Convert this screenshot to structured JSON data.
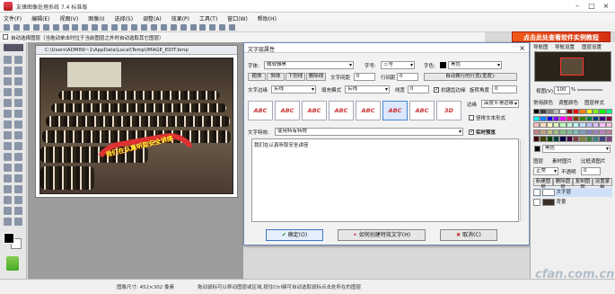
{
  "window": {
    "title": "友锋图像处理系统 7.4 标准版"
  },
  "menu": [
    "文件(F)",
    "编辑(E)",
    "视图(V)",
    "图像(I)",
    "选择(S)",
    "调整(A)",
    "效果(P)",
    "工具(T)",
    "窗口(W)",
    "帮助(H)"
  ],
  "options_bar": {
    "auto_select_layer": "自动选择图层（当拖动单击时位于当前图层之外时自动选取其它图层）"
  },
  "promo": {
    "label": "点击此处查看软件实例教程"
  },
  "image_window": {
    "path": "C:\\Users\\ADMINI~1\\AppData\\Local\\Temp\\IMAGE_EDIT.bmp",
    "overlay_text": "我们在认真听取安全讲座"
  },
  "dialog": {
    "title": "文字层属性",
    "font_label": "字体:",
    "font_value": "微软雅黑",
    "size_label": "字号:",
    "size_value": "三号",
    "color_label": "字色:",
    "color_value": "黑色",
    "style_buttons": [
      "粗体",
      "斜体",
      "下划线",
      "删除线"
    ],
    "spacing_label": "文字间距",
    "spacing_value": "0",
    "linespacing_label": "行间距",
    "linespacing_value": "0",
    "auto_wrap_label": "自动换行的行宽(宽度):",
    "text_edge_label": "文字边缘",
    "text_edge_value": "实线",
    "fill_mode_label": "填充模式",
    "fill_mode_value": "实线",
    "line_width_label": "线宽",
    "line_width_value": "0",
    "smooth_label": "抗锯齿边缘",
    "rotate_label": "旋转角度",
    "rotate_value": "0",
    "border_label": "边缘",
    "border_value": "高度平滑边缘",
    "effect_samples": [
      "ABC",
      "ABC",
      "ABC",
      "ABC",
      "ABC",
      "ABC",
      "ABC",
      "3D"
    ],
    "vertical_label": "竖排文本形式",
    "text_effect_label": "文字特效:",
    "text_effect_value": "使用特有特效",
    "realtime_label": "实时预览",
    "content": "我们在认真听取安全讲座",
    "ok_label": "确定(O)",
    "create_effect_label": "如何创建特效文字(H)",
    "cancel_label": "取消(C)"
  },
  "right_panel": {
    "tabs": [
      "导航图",
      "导航设置",
      "图层设置"
    ],
    "zoom_label": "视图(V)",
    "zoom_value": "100",
    "zoom_percent": "%",
    "palette_tabs": [
      "常用颜色",
      "调整颜色",
      "图层样式"
    ],
    "palette_colors": [
      "#000000",
      "#3f3f3f",
      "#7f7f7f",
      "#bfbfbf",
      "#ffffff",
      "#7f0000",
      "#ff0000",
      "#ff7f00",
      "#ffff00",
      "#7fff00",
      "#00ff00",
      "#00ff7f",
      "#00ffff",
      "#007fff",
      "#0000ff",
      "#7f00ff",
      "#ff00ff",
      "#ff007f",
      "#7f3f00",
      "#3f7f00",
      "#007f3f",
      "#003f7f",
      "#3f007f",
      "#7f003f",
      "#ffbfbf",
      "#ffdfbf",
      "#ffffbf",
      "#dfffbf",
      "#bfffbf",
      "#bfffdf",
      "#bfffff",
      "#bfdfff",
      "#bfbfff",
      "#dfbfff",
      "#ffbfff",
      "#ffbfdf",
      "#c08080",
      "#c0a080",
      "#c0c080",
      "#a0c080",
      "#80c080",
      "#80c0a0",
      "#80c0c0",
      "#80a0c0",
      "#8080c0",
      "#a080c0",
      "#c080c0",
      "#c080a0",
      "#400000",
      "#404000",
      "#004000",
      "#004040",
      "#000040",
      "#400040",
      "#804040",
      "#808040",
      "#408040",
      "#408080",
      "#404080",
      "#804080"
    ],
    "current_color": "黑色",
    "layer_tabs": [
      "图层",
      "素材图片",
      "比框调图片"
    ],
    "blend_label": "正常",
    "opacity_label": "不透明",
    "opacity_value": "0",
    "layer_buttons": [
      "新建图层",
      "删除图层",
      "复制图层",
      "设置蒙板"
    ],
    "layers": [
      "文字层",
      "背景"
    ]
  },
  "statusbar": {
    "size_text": "图像尺寸: 452×302 像素",
    "hint_text": "拖动鼠标可以移动图层或区域,按住Ctrl键可自动选取鼠标点击处所在的图层"
  },
  "watermark": "cfan.com.cn"
}
